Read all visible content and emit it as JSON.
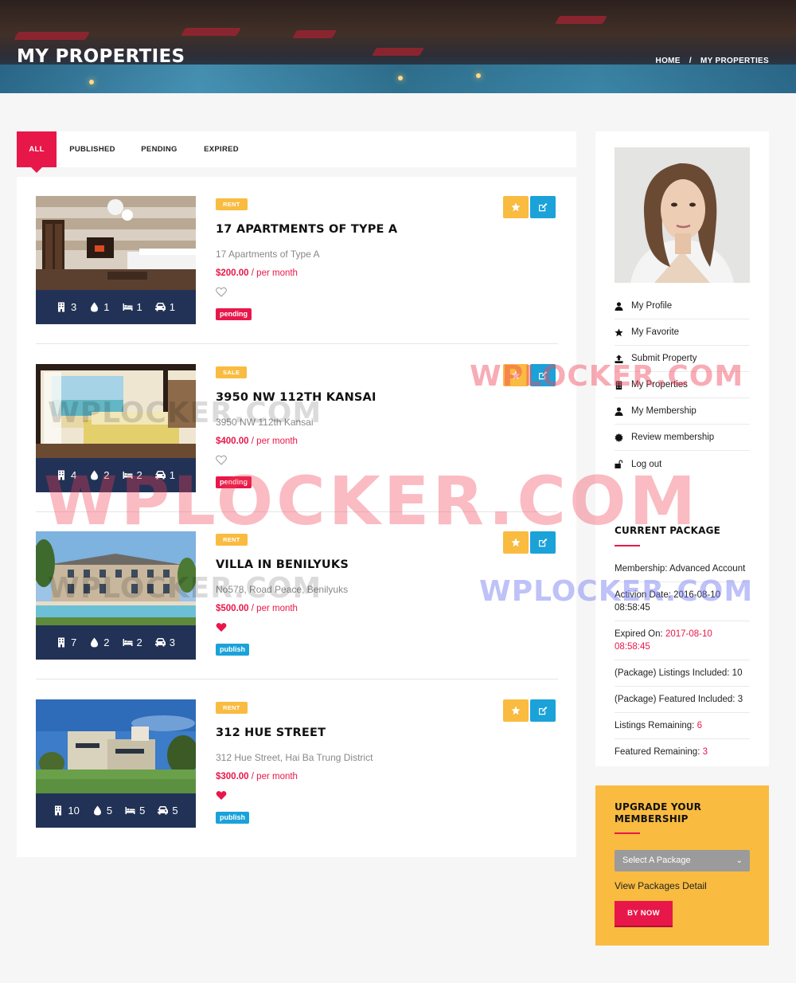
{
  "header": {
    "title": "MY PROPERTIES",
    "breadcrumb": {
      "home": "HOME",
      "separator": "/",
      "current": "MY PROPERTIES"
    }
  },
  "tabs": [
    "ALL",
    "PUBLISHED",
    "PENDING",
    "EXPIRED"
  ],
  "active_tab": "ALL",
  "properties": [
    {
      "type": "RENT",
      "title": "17 APARTMENTS OF TYPE A",
      "address": "17 Apartments of Type A",
      "price": "$200.00",
      "period": "/ per month",
      "favorited": false,
      "status": "pending",
      "stats": {
        "rooms": "3",
        "baths": "1",
        "beds": "1",
        "garages": "1"
      }
    },
    {
      "type": "SALE",
      "title": "3950 NW 112TH KANSAI",
      "address": "3950 NW 112th Kansai",
      "price": "$400.00",
      "period": "/ per month",
      "favorited": false,
      "status": "pending",
      "stats": {
        "rooms": "4",
        "baths": "2",
        "beds": "2",
        "garages": "1"
      }
    },
    {
      "type": "RENT",
      "title": "VILLA IN BENILYUKS",
      "address": "No578, Road Peace, Benilyuks",
      "price": "$500.00",
      "period": "/ per month",
      "favorited": true,
      "status": "publish",
      "stats": {
        "rooms": "7",
        "baths": "2",
        "beds": "2",
        "garages": "3"
      }
    },
    {
      "type": "RENT",
      "title": "312 HUE STREET",
      "address": "312 Hue Street, Hai Ba Trung District",
      "price": "$300.00",
      "period": "/ per month",
      "favorited": true,
      "status": "publish",
      "stats": {
        "rooms": "10",
        "baths": "5",
        "beds": "5",
        "garages": "5"
      }
    }
  ],
  "sidebar": {
    "menu": [
      "My Profile",
      "My Favorite",
      "Submit Property",
      "My Properties",
      "My Membership",
      "Review membership",
      "Log out"
    ],
    "package": {
      "title": "CURRENT PACKAGE",
      "membership_label": "Membership:",
      "membership_value": "Advanced Account",
      "activation_label": "Activion Date:",
      "activation_value": "2016-08-10 08:58:45",
      "expired_label": "Expired On:",
      "expired_value": "2017-08-10 08:58:45",
      "listings_included_label": "(Package) Listings Included:",
      "listings_included_value": "10",
      "featured_included_label": "(Package) Featured Included:",
      "featured_included_value": "3",
      "listings_remaining_label": "Listings Remaining:",
      "listings_remaining_value": "6",
      "featured_remaining_label": "Featured Remaining:",
      "featured_remaining_value": "3"
    },
    "upgrade": {
      "title": "UPGRADE YOUR MEMBERSHIP",
      "select_placeholder": "Select A Package",
      "view_link": "View Packages Detail",
      "buy_button": "BY NOW"
    }
  },
  "watermark": "WPLOCKER.COM",
  "colors": {
    "accent": "#e8174a",
    "badge_yellow": "#f9bb40",
    "publish_blue": "#1aa2d9",
    "stats_navy": "#223256"
  }
}
